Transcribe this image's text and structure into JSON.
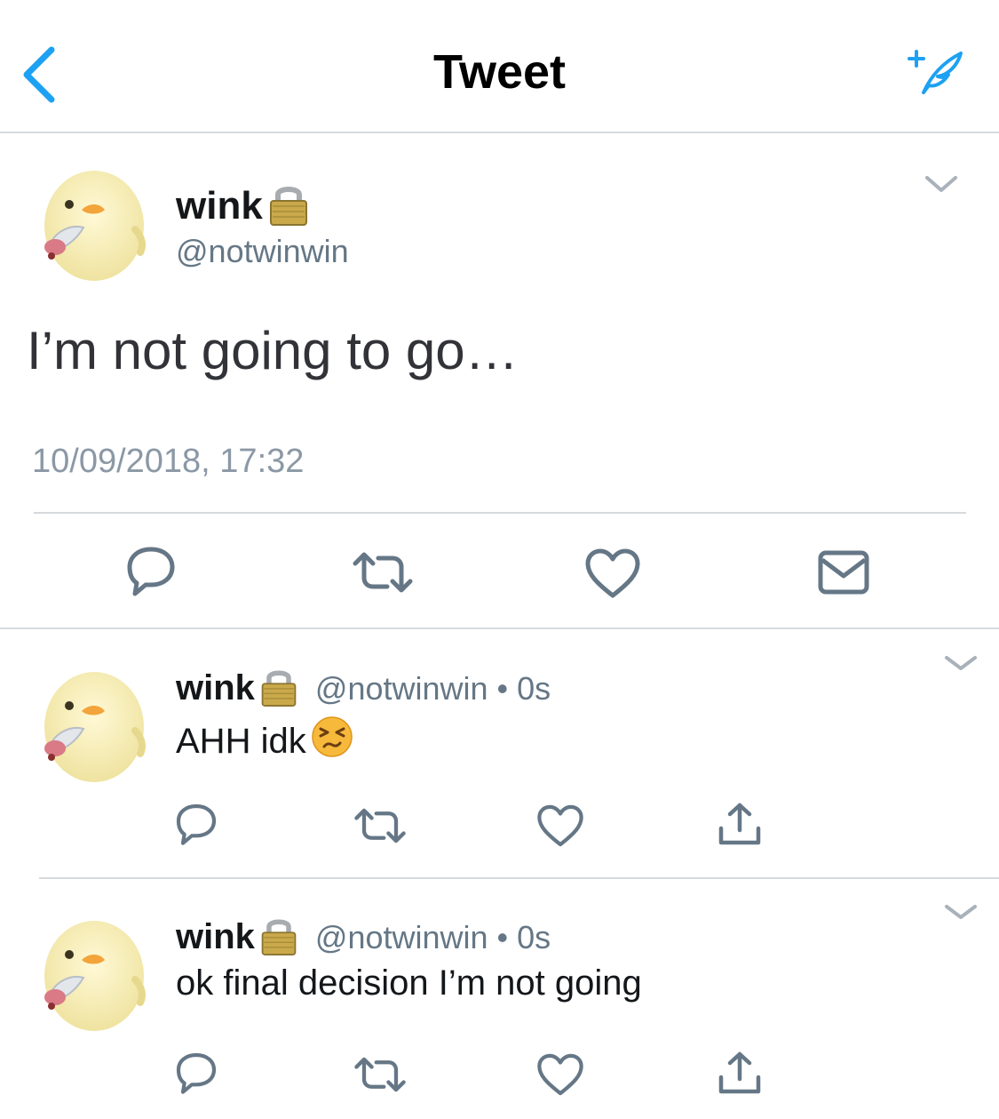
{
  "header": {
    "title": "Tweet",
    "back_icon": "chevron-left-icon",
    "compose_icon": "compose-tweet-icon",
    "accent_color": "#1da1f2"
  },
  "main_tweet": {
    "name": "wink",
    "handle": "@notwinwin",
    "text": "I’m not going to go…",
    "timestamp": "10/09/2018, 17:32",
    "actions": [
      "reply-icon",
      "retweet-icon",
      "like-icon",
      "message-icon"
    ]
  },
  "replies": [
    {
      "name": "wink",
      "handle_time": "@notwinwin • 0s",
      "text": "AHH idk",
      "emoji": "persevering-face-emoji",
      "actions": [
        "reply-icon",
        "retweet-icon",
        "like-icon",
        "share-icon"
      ]
    },
    {
      "name": "wink",
      "handle_time": "@notwinwin • 0s",
      "text": "ok final decision I’m not going",
      "actions": [
        "reply-icon",
        "retweet-icon",
        "like-icon",
        "share-icon"
      ]
    }
  ]
}
